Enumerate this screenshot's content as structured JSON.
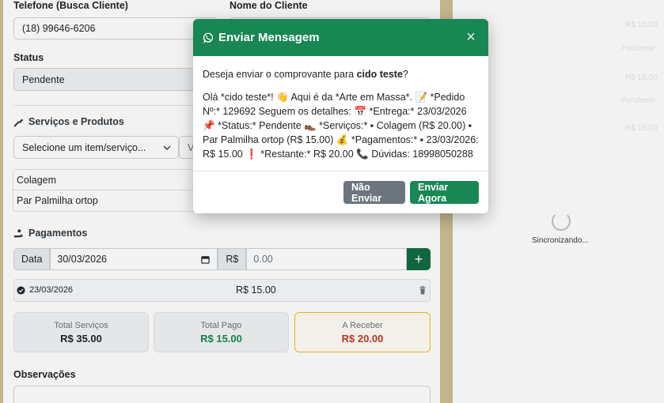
{
  "form": {
    "phone_label": "Telefone (Busca Cliente)",
    "phone_value": "(18) 99646-6206",
    "name_label": "Nome do Cliente",
    "status_label": "Status",
    "status_value": "Pendente",
    "services_title": "Serviços e Produtos",
    "item_select_placeholder": "Selecione um item/serviço...",
    "value_prefix": "V",
    "items": [
      "Colagem",
      "Par Palmilha ortop"
    ],
    "payments_title": "Pagamentos",
    "date_label": "Data",
    "date_value": "30/03/2026",
    "currency_label": "R$",
    "amount_placeholder": "0.00",
    "add_symbol": "+",
    "payment_entry": {
      "date": "23/03/2026",
      "amount": "R$ 15.00"
    },
    "total_services_label": "Total Serviços",
    "total_services_value": "R$ 35.00",
    "total_paid_label": "Total Pago",
    "total_paid_value": "R$ 15.00",
    "to_receive_label": "A Receber",
    "to_receive_value": "R$ 20.00",
    "notes_label": "Observações"
  },
  "sidebar": {
    "sync_text": "Sincronizando...",
    "faded": [
      "R$ 15.00",
      "Pendente",
      "R$ 15.00",
      "Pendente",
      "R$ 15.00"
    ]
  },
  "modal": {
    "title": "Enviar Mensagem",
    "close_symbol": "×",
    "question_prefix": "Deseja enviar o comprovante para ",
    "client_name": "cido teste",
    "question_suffix": "?",
    "message": "Olá *cido teste*! 👋 Aqui é da *Arte em Massa*. 📝 *Pedido Nº:* 129692 Seguem os detalhes: 📅 *Entrega:* 23/03/2026 📌 *Status:* Pendente 👞 *Serviços:* ▪ Colagem (R$ 20.00) ▪ Par Palmilha ortop (R$ 15.00) 💰 *Pagamentos:* ▪ 23/03/2026: R$ 15.00 ❗ *Restante:* R$ 20.00 📞 Dúvidas: 18998050288",
    "cancel_label": "Não Enviar",
    "confirm_label": "Enviar Agora"
  },
  "colors": {
    "accent": "#198754",
    "warning_border": "#f0c21a",
    "danger": "#c0392b"
  }
}
